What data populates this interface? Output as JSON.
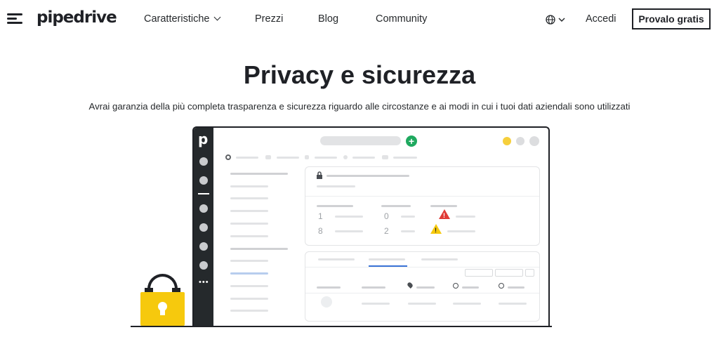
{
  "nav": {
    "logo": "pipedrive",
    "links": [
      "Caratteristiche",
      "Prezzi",
      "Blog",
      "Community"
    ],
    "login": "Accedi",
    "cta": "Provalo gratis"
  },
  "hero": {
    "title": "Privacy e sicurezza",
    "subtitle": "Avrai garanzia della più completa trasparenza e sicurezza riguardo alle circostanze e ai modi in cui i tuoi dati aziendali sono utilizzati"
  },
  "illustration": {
    "app_letter": "p",
    "plus": "+",
    "more": "•••",
    "stats": [
      "1",
      "0",
      "8",
      "2"
    ],
    "warn_mark": "!"
  },
  "colors": {
    "brand_dark": "#1f2126",
    "accent_green": "#1fa95f",
    "warn_red": "#e03b36",
    "warn_yellow": "#f6c90d",
    "lock_yellow": "#f6c90d"
  }
}
